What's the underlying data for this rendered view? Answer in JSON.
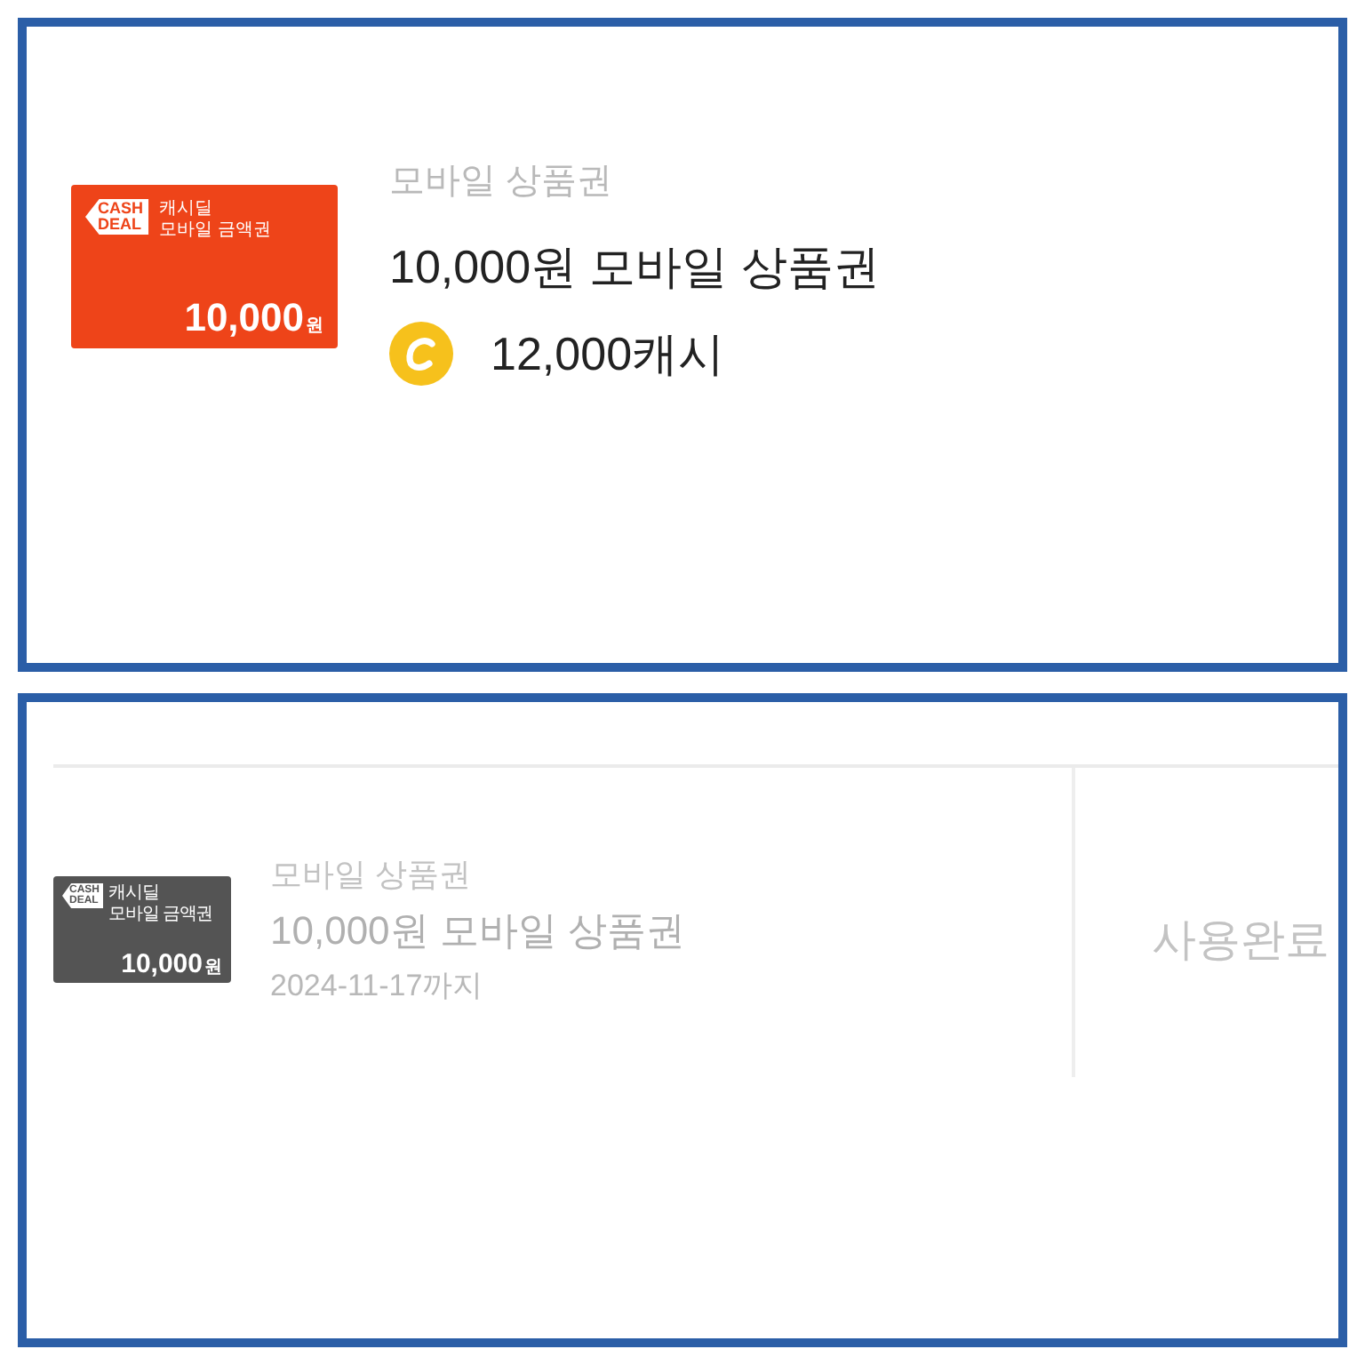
{
  "panels": [
    {
      "kind": "purchase",
      "thumbnail": {
        "tag": [
          "CASH",
          "DEAL"
        ],
        "caption": [
          "캐시딜",
          "모바일 금액권"
        ],
        "amount": "10,000",
        "unit": "원"
      },
      "category": "모바일 상품권",
      "title": "10,000원 모바일 상품권",
      "price": "12,000캐시"
    },
    {
      "kind": "coupon",
      "used": true,
      "thumbnail": {
        "tag": [
          "CASH",
          "DEAL"
        ],
        "caption": [
          "캐시딜",
          "모바일 금액권"
        ],
        "amount": "10,000",
        "unit": "원"
      },
      "category": "모바일 상품권",
      "title": "10,000원 모바일 상품권",
      "expiry": "2024-11-17까지",
      "status": "사용완료"
    }
  ]
}
